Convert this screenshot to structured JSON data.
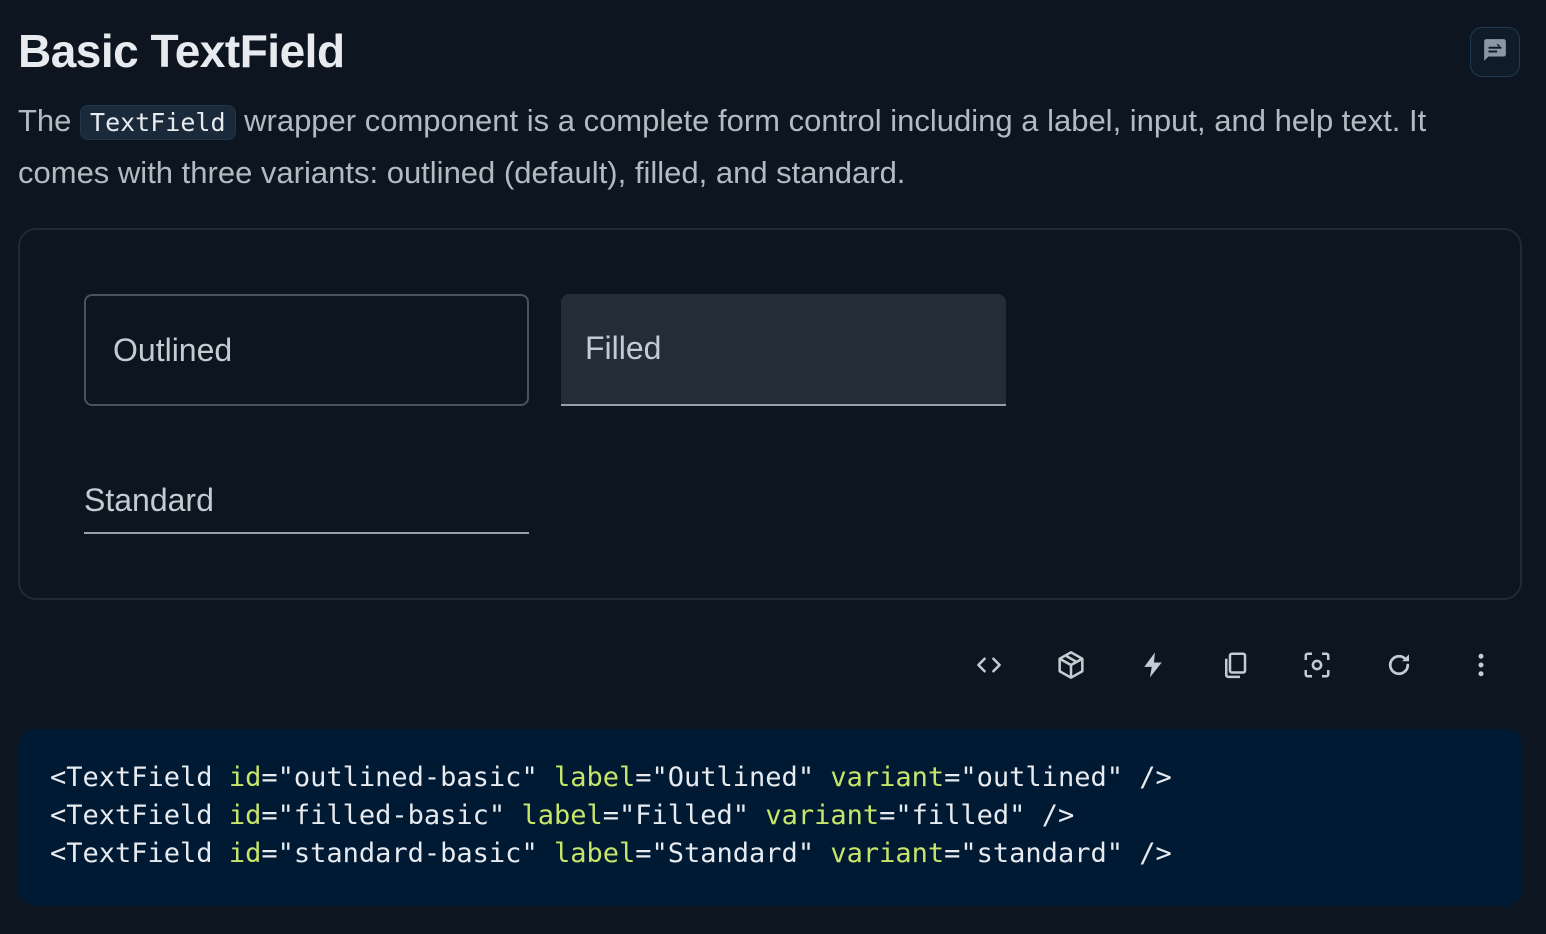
{
  "header": {
    "title": "Basic TextField",
    "feedback_icon": "feedback-icon"
  },
  "description": {
    "before_code": "The ",
    "code": "TextField",
    "after_code": " wrapper component is a complete form control including a label, input, and help text. It comes with three variants: outlined (default), filled, and standard."
  },
  "demo": {
    "outlined": {
      "label": "Outlined",
      "value": ""
    },
    "filled": {
      "label": "Filled",
      "value": ""
    },
    "standard": {
      "label": "Standard",
      "value": ""
    }
  },
  "toolbar": {
    "buttons": [
      {
        "icon": "code-icon"
      },
      {
        "icon": "cube-icon"
      },
      {
        "icon": "bolt-icon"
      },
      {
        "icon": "copy-icon"
      },
      {
        "icon": "screenshot-icon"
      },
      {
        "icon": "reset-icon"
      },
      {
        "icon": "more-vert-icon"
      }
    ]
  },
  "code": {
    "lines": [
      {
        "tag": "<TextField",
        "a1": "id",
        "v1": "\"outlined-basic\"",
        "a2": "label",
        "v2": "\"Outlined\"",
        "a3": "variant",
        "v3": "\"outlined\"",
        "end": "/>"
      },
      {
        "tag": "<TextField",
        "a1": "id",
        "v1": "\"filled-basic\"",
        "a2": "label",
        "v2": "\"Filled\"",
        "a3": "variant",
        "v3": "\"filled\"",
        "end": "/>"
      },
      {
        "tag": "<TextField",
        "a1": "id",
        "v1": "\"standard-basic\"",
        "a2": "label",
        "v2": "\"Standard\"",
        "a3": "variant",
        "v3": "\"standard\"",
        "end": "/>"
      }
    ]
  },
  "colors": {
    "background": "#0d1620",
    "code_background": "#001a33",
    "attribute": "#c7e56a",
    "text": "#e7ebf0",
    "muted_text": "#b2bac2"
  }
}
